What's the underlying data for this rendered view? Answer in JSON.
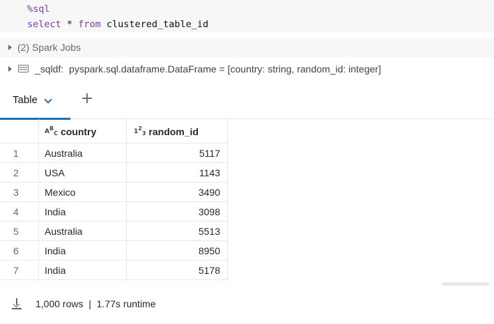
{
  "code": {
    "line1": "%sql",
    "line2_keywords": [
      "select",
      "*",
      "from"
    ],
    "line2_table": "clustered_table_id"
  },
  "jobs": {
    "label": "(2) Spark Jobs"
  },
  "schema": {
    "text": "_sqldf:  pyspark.sql.dataframe.DataFrame = [country: string, random_id: integer]"
  },
  "tabs": {
    "active_label": "Table",
    "add_icon": "plus-icon"
  },
  "table": {
    "columns": [
      {
        "name": "country",
        "type_icon": "string-type-icon"
      },
      {
        "name": "random_id",
        "type_icon": "integer-type-icon"
      }
    ],
    "rows": [
      {
        "index": "1",
        "country": "Australia",
        "random_id": "5117"
      },
      {
        "index": "2",
        "country": "USA",
        "random_id": "1143"
      },
      {
        "index": "3",
        "country": "Mexico",
        "random_id": "3490"
      },
      {
        "index": "4",
        "country": "India",
        "random_id": "3098"
      },
      {
        "index": "5",
        "country": "Australia",
        "random_id": "5513"
      },
      {
        "index": "6",
        "country": "India",
        "random_id": "8950"
      },
      {
        "index": "7",
        "country": "India",
        "random_id": "5178"
      }
    ]
  },
  "footer": {
    "summary": "1,000 rows  |  1.77s runtime",
    "download_icon": "download-icon"
  },
  "colors": {
    "accent": "#2272b4",
    "keyword": "#7a3e9d"
  }
}
